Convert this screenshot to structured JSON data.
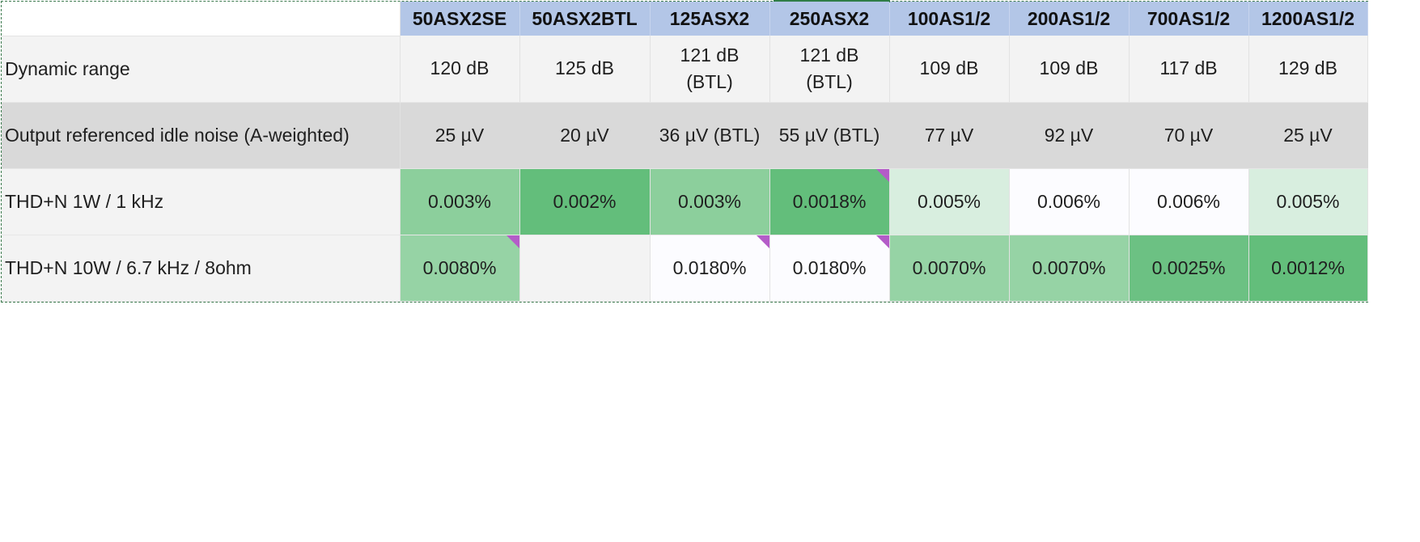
{
  "columns": [
    "50ASX2SE",
    "50ASX2BTL",
    "125ASX2",
    "250ASX2",
    "100AS1/2",
    "200AS1/2",
    "700AS1/2",
    "1200AS1/2"
  ],
  "rows": [
    {
      "label": "Dynamic range",
      "cells": [
        "120 dB",
        "125 dB",
        "121 dB (BTL)",
        "121 dB (BTL)",
        "109 dB",
        "109 dB",
        "117 dB",
        "129 dB"
      ]
    },
    {
      "label": "Output referenced idle noise (A-weighted)",
      "cells": [
        "25 µV",
        "20 µV",
        "36 µV (BTL)",
        "55 µV (BTL)",
        "77 µV",
        "92 µV",
        "70 µV",
        "25 µV"
      ]
    },
    {
      "label": "THD+N 1W / 1 kHz",
      "cells": [
        "0.003%",
        "0.002%",
        "0.003%",
        "0.0018%",
        "0.005%",
        "0.006%",
        "0.006%",
        "0.005%"
      ]
    },
    {
      "label": "THD+N 10W / 6.7 kHz / 8ohm",
      "cells": [
        "0.0080%",
        "",
        "0.0180%",
        "0.0180%",
        "0.0070%",
        "0.0070%",
        "0.0025%",
        "0.0012%"
      ]
    }
  ],
  "colors": {
    "header_bg": "#b3c6e7",
    "row_light": "#f3f3f3",
    "row_mid": "#d9d9d9",
    "note_marker": "#b45cc8",
    "selection_border": "#3c7a4e"
  }
}
